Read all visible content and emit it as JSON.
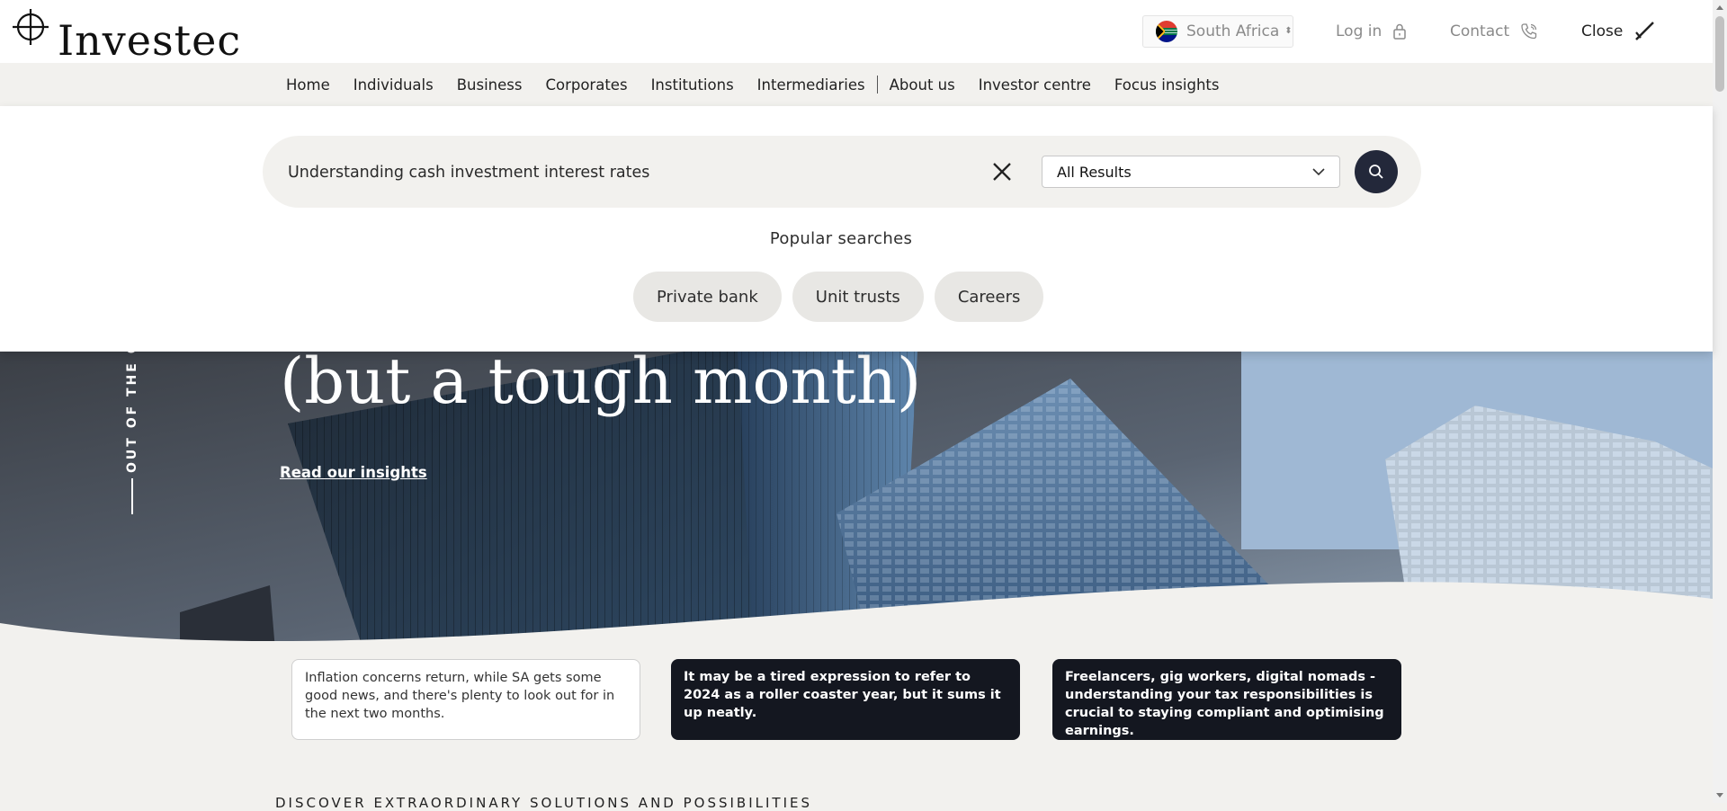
{
  "header": {
    "logo_text": "Investec",
    "country": "South Africa",
    "login": "Log in",
    "contact": "Contact",
    "close": "Close"
  },
  "nav": {
    "items": [
      "Home",
      "Individuals",
      "Business",
      "Corporates",
      "Institutions",
      "Intermediaries",
      "About us",
      "Investor centre",
      "Focus insights"
    ]
  },
  "search": {
    "query": "Understanding cash investment interest rates",
    "filter": "All Results",
    "popular_title": "Popular searches",
    "popular": [
      "Private bank",
      "Unit trusts",
      "Careers"
    ]
  },
  "hero": {
    "vertical_label": "OUT OF THE O",
    "title": "(but a tough month)",
    "link": "Read our insights"
  },
  "cards": [
    {
      "text": "Inflation concerns return, while SA gets some good news, and there's plenty to look out for in the next two months."
    },
    {
      "text": "It may be a tired expression to refer to 2024 as a roller coaster year, but it sums it up neatly."
    },
    {
      "text": "Freelancers, gig workers, digital nomads - understanding your tax responsibilities is crucial to staying compliant and optimising earnings."
    }
  ],
  "bottom_heading": "DISCOVER EXTRAORDINARY SOLUTIONS AND POSSIBILITIES"
}
